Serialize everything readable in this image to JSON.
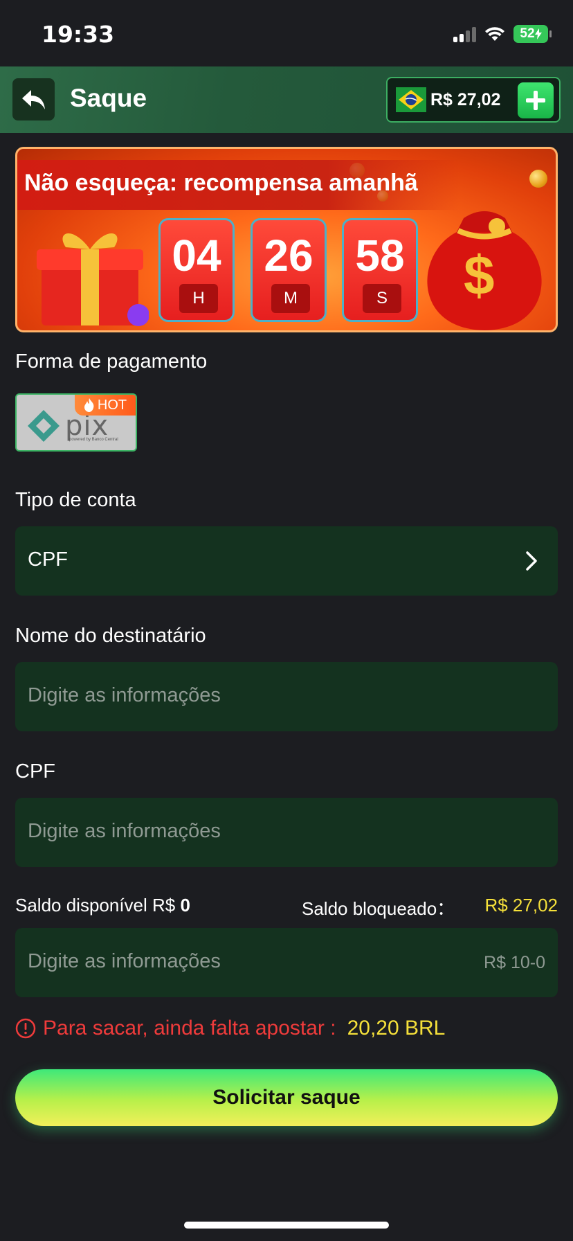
{
  "status_bar": {
    "time": "19:33",
    "battery": "52"
  },
  "header": {
    "title": "Saque",
    "balance": "R$ 27,02"
  },
  "banner": {
    "title": "Não esqueça: recompensa amanhã",
    "timer": [
      {
        "value": "04",
        "unit": "H"
      },
      {
        "value": "26",
        "unit": "M"
      },
      {
        "value": "58",
        "unit": "S"
      }
    ]
  },
  "payment": {
    "label": "Forma de pagamento",
    "method_logo": "pix",
    "method_sub": "powered by Banco Central",
    "badge": "HOT"
  },
  "account_type": {
    "label": "Tipo de conta",
    "value": "CPF"
  },
  "recipient": {
    "label": "Nome do destinatário",
    "placeholder": "Digite as informações"
  },
  "cpf": {
    "label": "CPF",
    "placeholder": "Digite as informações"
  },
  "saldo": {
    "available_label": "Saldo disponível R$",
    "available_value": "0",
    "blocked_label": "Saldo bloqueado：",
    "blocked_value": "R$ 27,02"
  },
  "amount": {
    "placeholder": "Digite as informações",
    "range": "R$ 10-0"
  },
  "warning": {
    "text": "Para sacar, ainda falta apostar :",
    "value": "20,20 BRL"
  },
  "submit_label": "Solicitar saque",
  "colors": {
    "background": "#1c1d21",
    "field": "#14321f",
    "accent_green": "#3cb464",
    "warning_red": "#ef3b3b",
    "highlight_yellow": "#f5e03a"
  }
}
